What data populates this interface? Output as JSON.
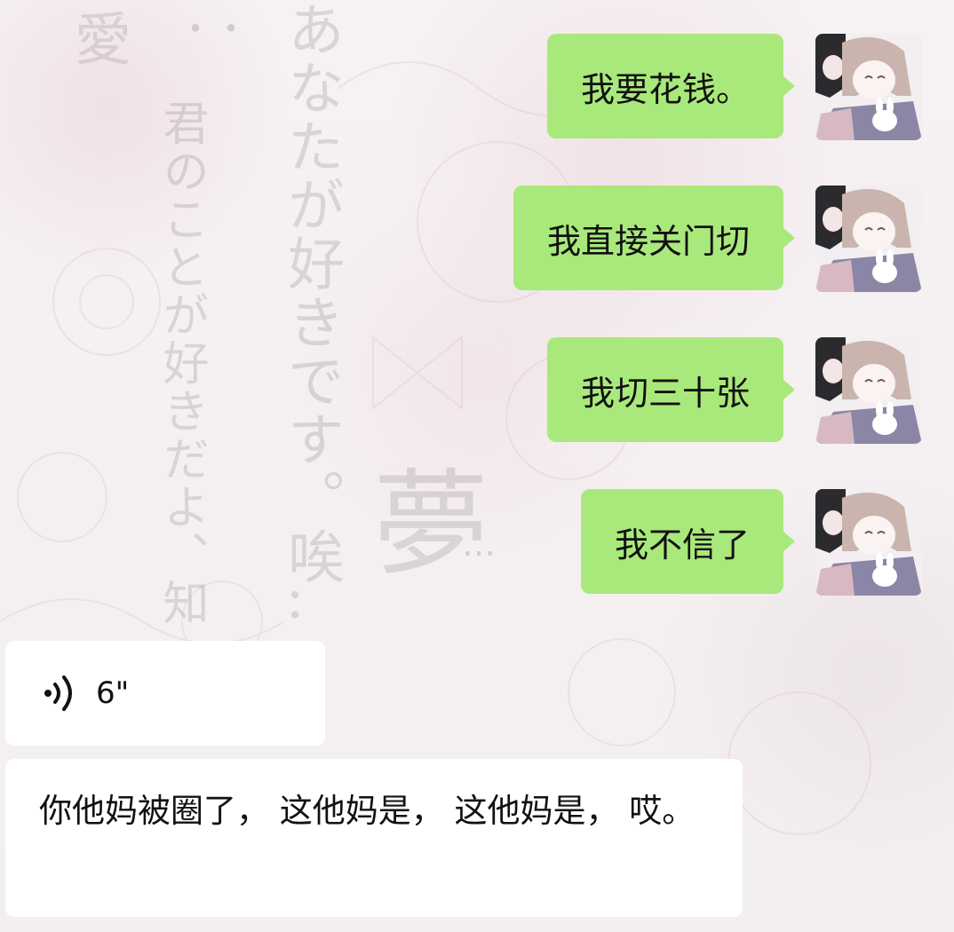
{
  "background": {
    "vertical_text_1": "あなたが好きです。唉..",
    "vertical_text_2": "君のことが好きだよ、知",
    "corner_text": "愛",
    "corner_dots": "・・",
    "large_char": "夢",
    "large_dots": "..."
  },
  "chat": {
    "bubble_color": "#a9e97b",
    "incoming_bubble_color": "#ffffff",
    "outgoing_messages": [
      {
        "text": "我要花钱。"
      },
      {
        "text": "我直接关门切"
      },
      {
        "text": "我切三十张"
      },
      {
        "text": "我不信了"
      }
    ],
    "voice_message": {
      "icon": "voice-wave-icon",
      "duration": "6\""
    },
    "transcription": {
      "text": "你他妈被圈了， 这他妈是， 这他妈是， 哎。"
    }
  }
}
